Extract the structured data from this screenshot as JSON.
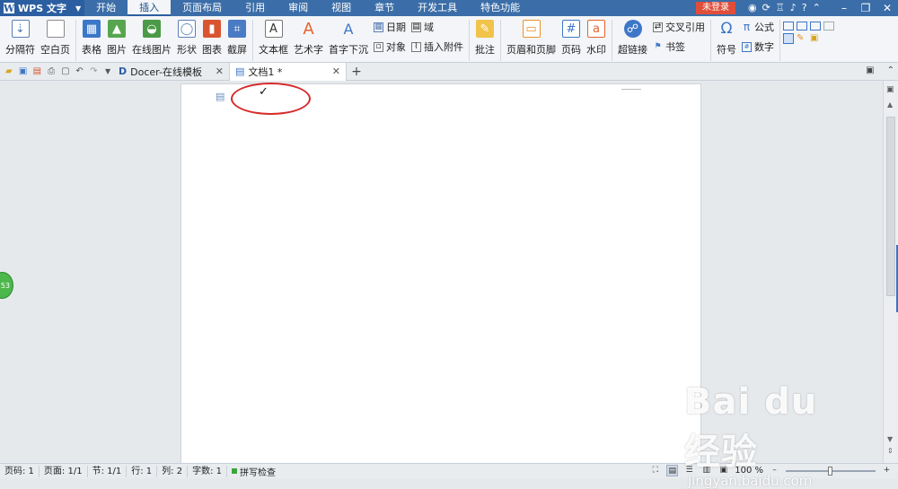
{
  "app": {
    "name": "WPS 文字"
  },
  "menu_tabs": [
    "开始",
    "插入",
    "页面布局",
    "引用",
    "审阅",
    "视图",
    "章节",
    "开发工具",
    "特色功能"
  ],
  "active_menu_tab": "插入",
  "login_button": "未登录",
  "ribbon": {
    "page_break": "分隔符",
    "blank_page": "空白页",
    "table": "表格",
    "picture": "图片",
    "online_picture": "在线图片",
    "shapes": "形状",
    "chart": "图表",
    "screenshot": "截屏",
    "textbox": "文本框",
    "wordart": "艺术字",
    "dropcap": "首字下沉",
    "date": "日期",
    "field": "域",
    "object": "对象",
    "attachment": "插入附件",
    "comment": "批注",
    "header_footer": "页眉和页脚",
    "page_number": "页码",
    "watermark": "水印",
    "hyperlink": "超链接",
    "cross_reference": "交叉引用",
    "bookmark": "书签",
    "symbol": "符号",
    "formula": "公式",
    "number": "数字",
    "formula_glyph": "π",
    "symbol_glyph": "Ω"
  },
  "doc_tabs": [
    {
      "label": "Docer-在线模板"
    },
    {
      "label": "文档1 *"
    }
  ],
  "document": {
    "checkmark": "✓"
  },
  "side_badge": "53",
  "status": {
    "page": "页码: 1",
    "pages": "页面: 1/1",
    "section": "节: 1/1",
    "row": "行: 1",
    "col": "列: 2",
    "words": "字数: 1",
    "spell": "拼写检查",
    "zoom": "100 %"
  },
  "watermark": {
    "main": "Bai du 经验",
    "sub": "jingyan.baidu.com"
  },
  "colors": {
    "title_bar": "#3b6ea8",
    "accent": "#2b5ea0",
    "login": "#e04e3a",
    "highlight": "#d62a2a"
  },
  "icons": [
    "doc-icon",
    "close-icon",
    "plus-icon",
    "minimize-icon",
    "maximize-icon",
    "help-icon"
  ]
}
